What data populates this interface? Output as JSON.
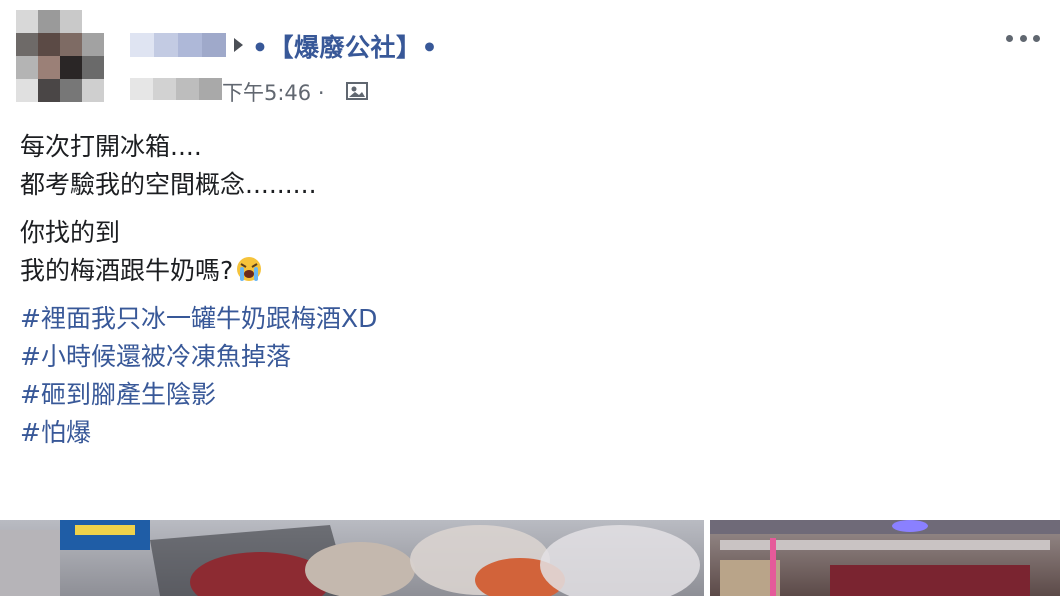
{
  "post": {
    "group_name": "•【爆廢公社】•",
    "timestamp": "下午5:46 ·",
    "author_name_hidden": true
  },
  "content": {
    "para1": [
      "每次打開冰箱....",
      "都考驗我的空間概念........."
    ],
    "para2_line1": "你找的到",
    "para2_line2": "我的梅酒跟牛奶嗎?",
    "hashtags": [
      "#裡面我只冰一罐牛奶跟梅酒XD",
      "#小時候還被冷凍魚掉落",
      "#砸到腳產生陰影",
      "#怕爆"
    ]
  },
  "icons": {
    "arrow": "triangle-right-icon",
    "audience": "public-photo-icon",
    "more": "more-options-icon",
    "emoji": "loudly-crying-face-icon"
  },
  "colors": {
    "link": "#385898",
    "text": "#1c1e21",
    "meta": "#616770"
  }
}
